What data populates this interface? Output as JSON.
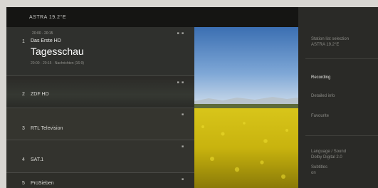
{
  "header": {
    "title": "ASTRA 19.2°E"
  },
  "channels": [
    {
      "number": "1",
      "name": "Das Erste HD",
      "time": "20:00 - 20:15",
      "program": "Tagesschau",
      "sub": "20:00 - 20:15 · Nachrichten (16:9)",
      "badges": "■ ■",
      "selected": true
    },
    {
      "number": "2",
      "name": "ZDF HD",
      "badges": "■ ■"
    },
    {
      "number": "3",
      "name": "RTL Television",
      "badges": "■"
    },
    {
      "number": "4",
      "name": "SAT.1",
      "badges": "■"
    },
    {
      "number": "5",
      "name": "ProSieben",
      "badges": "■"
    }
  ],
  "menu": {
    "station_list": "Station list selection",
    "station_list_value": "ASTRA 19.2°E",
    "items": [
      {
        "label": "Recording",
        "active": true
      },
      {
        "label": "Detailed info",
        "active": false
      },
      {
        "label": "Favourite",
        "active": false
      }
    ],
    "language": "Language / Sound",
    "language_value": "Dolby Digital 2.0",
    "subtitles": "Subtitles",
    "subtitles_value": "on"
  },
  "colors": {
    "background": "#1e1e1c",
    "selected_row": "#2f302d",
    "menu": "#2a2a27"
  }
}
